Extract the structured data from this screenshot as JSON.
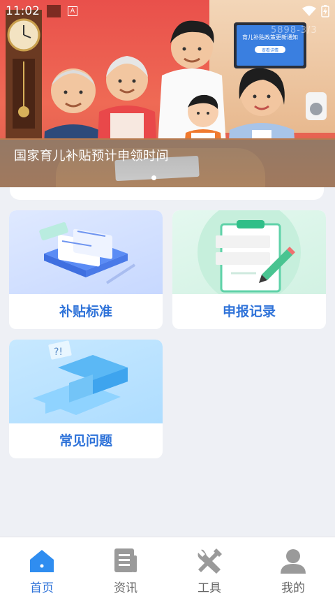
{
  "status_bar": {
    "time": "11:02",
    "notification_icon": "a-letter-icon",
    "watermark": "5898-3/3"
  },
  "banner": {
    "caption": "国家育儿补贴预计申领时间",
    "tv_title": "育儿补贴政策更新通知",
    "tv_button": "查看详情",
    "active_slide_dot": 1
  },
  "cards": [
    {
      "label": "补贴标准",
      "illustration": "documents-stack-illustration"
    },
    {
      "label": "申报记录",
      "illustration": "clipboard-pencil-illustration"
    },
    {
      "label": "常见问题",
      "illustration": "question-mark-illustration"
    }
  ],
  "bottom_nav": {
    "active_index": 0,
    "active_color": "#2f73d9",
    "inactive_color": "#666666",
    "items": [
      {
        "label": "首页",
        "icon": "home-icon"
      },
      {
        "label": "资讯",
        "icon": "news-icon"
      },
      {
        "label": "工具",
        "icon": "tools-icon"
      },
      {
        "label": "我的",
        "icon": "profile-icon"
      }
    ]
  }
}
